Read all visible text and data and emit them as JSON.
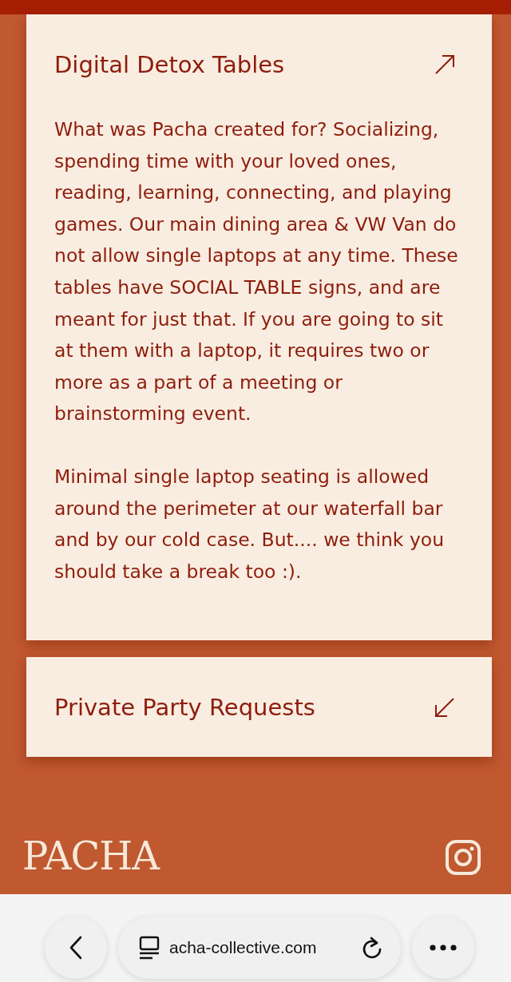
{
  "sections": [
    {
      "title": "Digital Detox Tables",
      "expanded": true,
      "paragraphs": [
        "What was Pacha created for? Socializing, spending time with your loved ones, reading, learning, connecting, and playing games. Our main dining area & VW Van do not allow single laptops at any time. These tables have SOCIAL TABLE signs, and are meant for just that. If you are going to sit at them with a laptop, it requires two or more as a part of a meeting or brainstorming event.",
        "Minimal single laptop seating is allowed around the perimeter at our waterfall bar and by our cold case. But.... we think you should take a break too :)."
      ]
    },
    {
      "title": "Private Party Requests",
      "expanded": false
    }
  ],
  "footer": {
    "logo": "PACHA"
  },
  "browser": {
    "url": "acha-collective.com"
  }
}
